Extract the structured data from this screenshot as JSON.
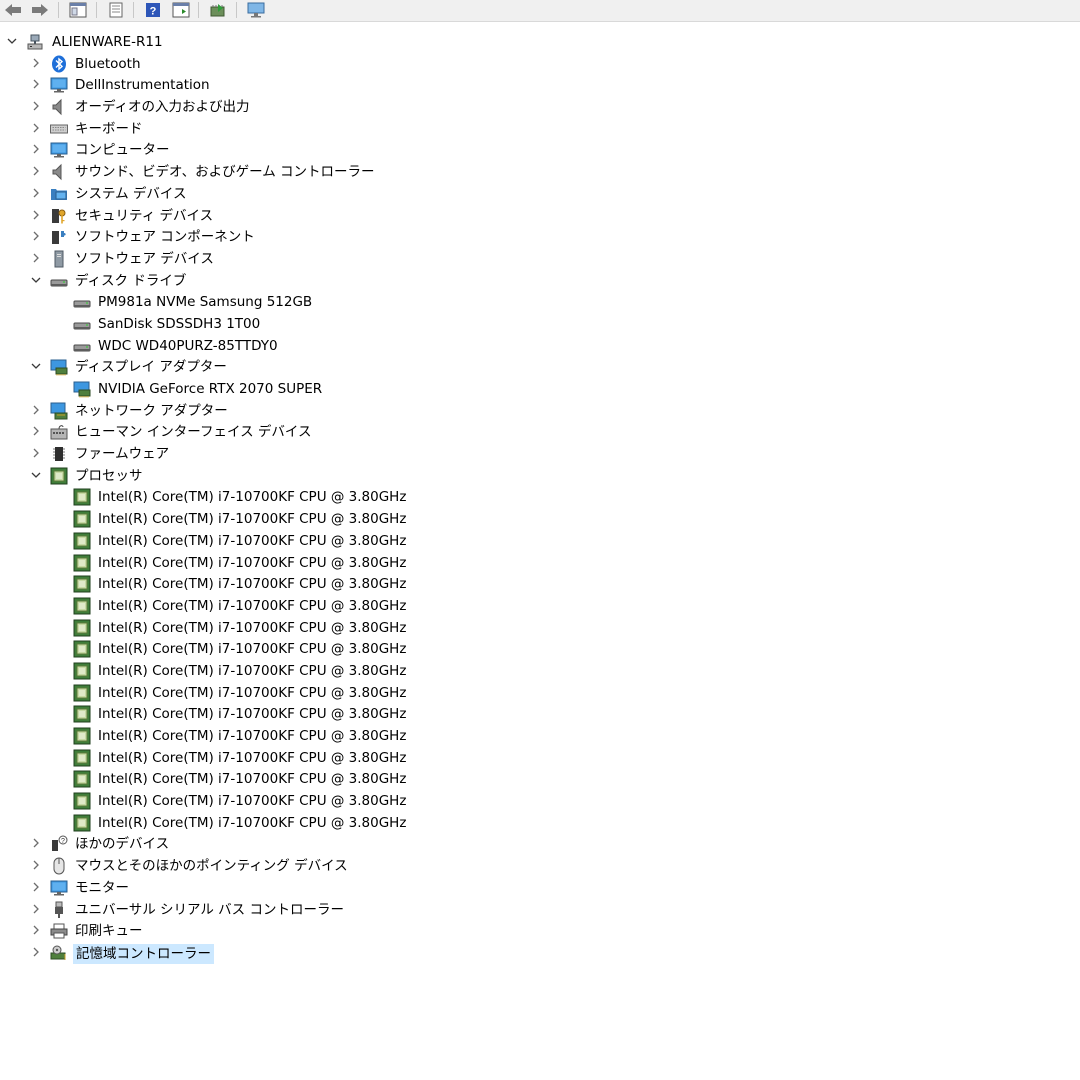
{
  "toolbar": {
    "buttons": [
      {
        "name": "back-button",
        "icon": "back-arrow-icon"
      },
      {
        "name": "forward-button",
        "icon": "forward-arrow-icon"
      },
      {
        "name": "show-hide-console-tree-button",
        "icon": "console-tree-icon"
      },
      {
        "name": "properties-button",
        "icon": "properties-icon"
      },
      {
        "name": "help-button",
        "icon": "help-icon"
      },
      {
        "name": "show-action-pane-button",
        "icon": "action-pane-icon"
      },
      {
        "name": "update-driver-button",
        "icon": "update-driver-icon"
      },
      {
        "name": "scan-hardware-button",
        "icon": "scan-monitor-icon"
      }
    ]
  },
  "tree": {
    "root": {
      "label": "ALIENWARE-R11",
      "icon": "computer-network-icon",
      "expanded": true
    },
    "categories": [
      {
        "label": "Bluetooth",
        "icon": "bluetooth-icon",
        "expanded": false
      },
      {
        "label": "DellInstrumentation",
        "icon": "monitor-icon",
        "expanded": false
      },
      {
        "label": "オーディオの入力および出力",
        "icon": "speaker-icon",
        "expanded": false
      },
      {
        "label": "キーボード",
        "icon": "keyboard-icon",
        "expanded": false
      },
      {
        "label": "コンピューター",
        "icon": "monitor-icon",
        "expanded": false
      },
      {
        "label": "サウンド、ビデオ、およびゲーム コントローラー",
        "icon": "speaker-icon",
        "expanded": false
      },
      {
        "label": "システム デバイス",
        "icon": "folder-monitor-icon",
        "expanded": false
      },
      {
        "label": "セキュリティ デバイス",
        "icon": "key-icon",
        "expanded": false
      },
      {
        "label": "ソフトウェア コンポーネント",
        "icon": "puzzle-icon",
        "expanded": false
      },
      {
        "label": "ソフトウェア デバイス",
        "icon": "tower-icon",
        "expanded": false
      },
      {
        "label": "ディスク ドライブ",
        "icon": "disk-icon",
        "expanded": true,
        "children": [
          {
            "label": "PM981a NVMe Samsung 512GB",
            "icon": "disk-icon"
          },
          {
            "label": "SanDisk SDSSDH3 1T00",
            "icon": "disk-icon"
          },
          {
            "label": "WDC WD40PURZ-85TTDY0",
            "icon": "disk-icon"
          }
        ]
      },
      {
        "label": "ディスプレイ アダプター",
        "icon": "display-adapter-icon",
        "expanded": true,
        "children": [
          {
            "label": "NVIDIA GeForce RTX 2070 SUPER",
            "icon": "display-adapter-icon"
          }
        ]
      },
      {
        "label": "ネットワーク アダプター",
        "icon": "network-adapter-icon",
        "expanded": false
      },
      {
        "label": "ヒューマン インターフェイス デバイス",
        "icon": "hid-icon",
        "expanded": false
      },
      {
        "label": "ファームウェア",
        "icon": "chip-icon",
        "expanded": false
      },
      {
        "label": "プロセッサ",
        "icon": "processor-icon",
        "expanded": true,
        "children": [
          {
            "label": "Intel(R) Core(TM) i7-10700KF CPU @ 3.80GHz",
            "icon": "processor-icon"
          },
          {
            "label": "Intel(R) Core(TM) i7-10700KF CPU @ 3.80GHz",
            "icon": "processor-icon"
          },
          {
            "label": "Intel(R) Core(TM) i7-10700KF CPU @ 3.80GHz",
            "icon": "processor-icon"
          },
          {
            "label": "Intel(R) Core(TM) i7-10700KF CPU @ 3.80GHz",
            "icon": "processor-icon"
          },
          {
            "label": "Intel(R) Core(TM) i7-10700KF CPU @ 3.80GHz",
            "icon": "processor-icon"
          },
          {
            "label": "Intel(R) Core(TM) i7-10700KF CPU @ 3.80GHz",
            "icon": "processor-icon"
          },
          {
            "label": "Intel(R) Core(TM) i7-10700KF CPU @ 3.80GHz",
            "icon": "processor-icon"
          },
          {
            "label": "Intel(R) Core(TM) i7-10700KF CPU @ 3.80GHz",
            "icon": "processor-icon"
          },
          {
            "label": "Intel(R) Core(TM) i7-10700KF CPU @ 3.80GHz",
            "icon": "processor-icon"
          },
          {
            "label": "Intel(R) Core(TM) i7-10700KF CPU @ 3.80GHz",
            "icon": "processor-icon"
          },
          {
            "label": "Intel(R) Core(TM) i7-10700KF CPU @ 3.80GHz",
            "icon": "processor-icon"
          },
          {
            "label": "Intel(R) Core(TM) i7-10700KF CPU @ 3.80GHz",
            "icon": "processor-icon"
          },
          {
            "label": "Intel(R) Core(TM) i7-10700KF CPU @ 3.80GHz",
            "icon": "processor-icon"
          },
          {
            "label": "Intel(R) Core(TM) i7-10700KF CPU @ 3.80GHz",
            "icon": "processor-icon"
          },
          {
            "label": "Intel(R) Core(TM) i7-10700KF CPU @ 3.80GHz",
            "icon": "processor-icon"
          },
          {
            "label": "Intel(R) Core(TM) i7-10700KF CPU @ 3.80GHz",
            "icon": "processor-icon"
          }
        ]
      },
      {
        "label": "ほかのデバイス",
        "icon": "unknown-device-icon",
        "expanded": false
      },
      {
        "label": "マウスとそのほかのポインティング デバイス",
        "icon": "mouse-icon",
        "expanded": false
      },
      {
        "label": "モニター",
        "icon": "monitor-icon",
        "expanded": false
      },
      {
        "label": "ユニバーサル シリアル バス コントローラー",
        "icon": "usb-icon",
        "expanded": false
      },
      {
        "label": "印刷キュー",
        "icon": "printer-icon",
        "expanded": false
      },
      {
        "label": "記憶域コントローラー",
        "icon": "storage-controller-icon",
        "expanded": false,
        "selected": true
      }
    ]
  },
  "colors": {
    "selection": "#cce8ff",
    "chevron": "#6d6d6d",
    "processor_green": "#3f7e3a"
  }
}
